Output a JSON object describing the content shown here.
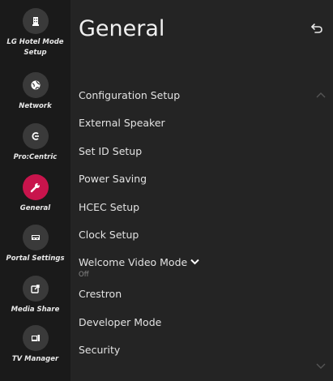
{
  "sidebar": {
    "items": [
      {
        "label_line1": "LG Hotel Mode",
        "label_line2": "Setup",
        "icon": "hotel-icon",
        "active": false
      },
      {
        "label_line1": "Network",
        "label_line2": "",
        "icon": "network-globe-icon",
        "active": false
      },
      {
        "label_line1": "Pro:Centric",
        "label_line2": "",
        "icon": "procentric-icon",
        "active": false
      },
      {
        "label_line1": "General",
        "label_line2": "",
        "icon": "wrench-icon",
        "active": true
      },
      {
        "label_line1": "Portal Settings",
        "label_line2": "",
        "icon": "portal-icon",
        "active": false
      },
      {
        "label_line1": "Media Share",
        "label_line2": "",
        "icon": "media-share-icon",
        "active": false
      },
      {
        "label_line1": "TV Manager",
        "label_line2": "",
        "icon": "tv-manager-icon",
        "active": false
      }
    ]
  },
  "panel": {
    "title": "General",
    "back_icon": "back-arrow-icon",
    "menu": [
      {
        "label": "Configuration Setup"
      },
      {
        "label": "External Speaker"
      },
      {
        "label": "Set ID Setup"
      },
      {
        "label": "Power Saving"
      },
      {
        "label": "HCEC Setup"
      },
      {
        "label": "Clock Setup"
      },
      {
        "label": "Welcome Video Mode",
        "value": "Off"
      },
      {
        "label": "Crestron"
      },
      {
        "label": "Developer Mode"
      },
      {
        "label": "Security"
      }
    ]
  },
  "colors": {
    "active_accent": "#c8144c",
    "background": "#242424",
    "sidebar": "#1a1a1a"
  }
}
